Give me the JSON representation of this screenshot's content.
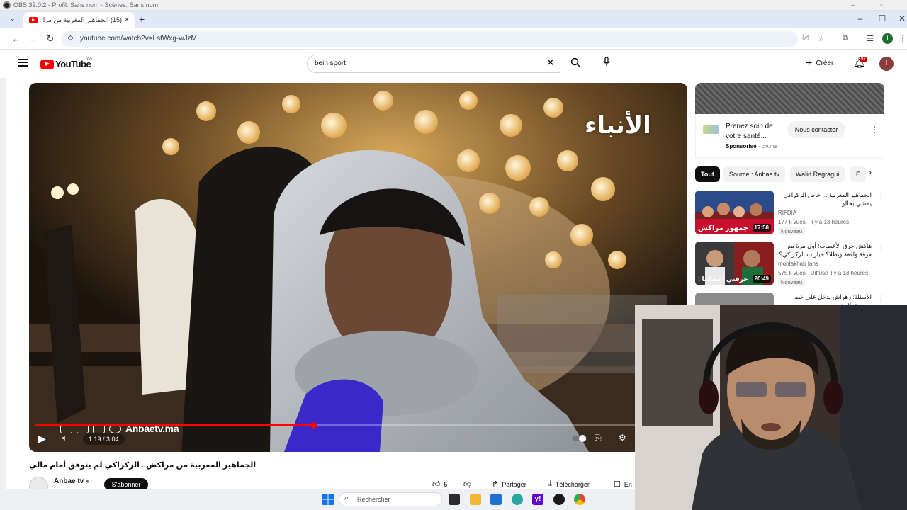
{
  "obs": {
    "title": "OBS 32.0.2 - Profil: Sans nom - Scènes: Sans nom"
  },
  "browser": {
    "tab_title": "(15) الجماهير المغربية من مرا",
    "new_tab": "+",
    "url": "youtube.com/watch?v=LstWxg-wJzM",
    "profile_initial": "I"
  },
  "youtube": {
    "logo_text": "YouTube",
    "country_code": "MA",
    "search_query": "bein sport",
    "create_label": "Créer",
    "notifications_badge": "9+",
    "avatar_initial": "I"
  },
  "player": {
    "time_display": "1:19 / 3:04",
    "progress_fraction": 0.43,
    "watermark_text": "الأنباء",
    "mic_label": "ANBAE TV",
    "social_handle": "Anbaetv.ma"
  },
  "video": {
    "title": "الجماهير المغربية من مراكش.. الركراكي لم يتوفق أمام مالي",
    "channel_name": "Anbae tv",
    "subscribe_label": "S'abonner",
    "likes": "5",
    "share_label": "Partager",
    "download_label": "Télécharger",
    "save_label": "En"
  },
  "ad": {
    "title": "Prenez soin de votre santé...",
    "sponsored_label": "Sponsorisé",
    "domain": "clv.ma",
    "cta_label": "Nous contacter"
  },
  "chips": [
    "Tout",
    "Source : Anbae tv",
    "Walid Regragui",
    "E"
  ],
  "recommendations": [
    {
      "title": "الجماهير المغربية ... خاص الركراكي يمشي بحالو",
      "channel": "RIFDIA",
      "meta": "177 k vues · il y a 13 heures",
      "badge": "Nouveau",
      "duration": "17:58",
      "thumb_caption": "جمهور مراكش"
    },
    {
      "title": "هاكش حرق الأعصاب! أول مرة مع فرقة واقفة وبطلا؟ خيارات الركراكي؟",
      "channel": "montakhab fans",
      "meta": "575 k vues · Diffusé il y a 13 heures",
      "badge": "Nouveau",
      "duration": "20:49",
      "thumb_caption": "حرقتي أعصابنا !"
    },
    {
      "title": "الأسئلة: زهراش يدخل على خط فضيحة الإرش",
      "channel": "",
      "meta": "",
      "badge": "",
      "duration": "",
      "thumb_caption": ""
    }
  ],
  "taskbar": {
    "search_placeholder": "Rechercher"
  },
  "colors": {
    "youtube_red": "#ff0000",
    "chip_active": "#0f0f0f",
    "tab_strip": "#dfe8f7"
  }
}
